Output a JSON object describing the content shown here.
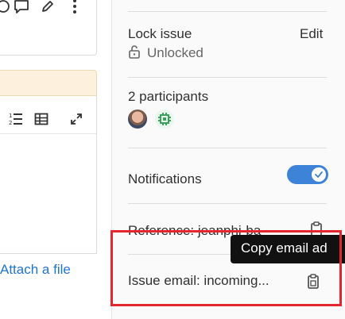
{
  "editor": {
    "attach_link": "Attach a file"
  },
  "sidebar": {
    "lock": {
      "title": "Lock issue",
      "edit": "Edit",
      "status": "Unlocked"
    },
    "participants": {
      "title": "2 participants"
    },
    "notifications": {
      "title": "Notifications",
      "enabled": true
    },
    "reference": {
      "text": "Reference: jeanphi-ba"
    },
    "issue_email": {
      "text": "Issue email: incoming..."
    },
    "tooltip": "Copy email ad"
  },
  "colors": {
    "accent_blue": "#1f75cb",
    "toggle_blue": "#3d84d8",
    "highlight_red": "#e3262f",
    "warning_bg": "#fdf1dd"
  }
}
